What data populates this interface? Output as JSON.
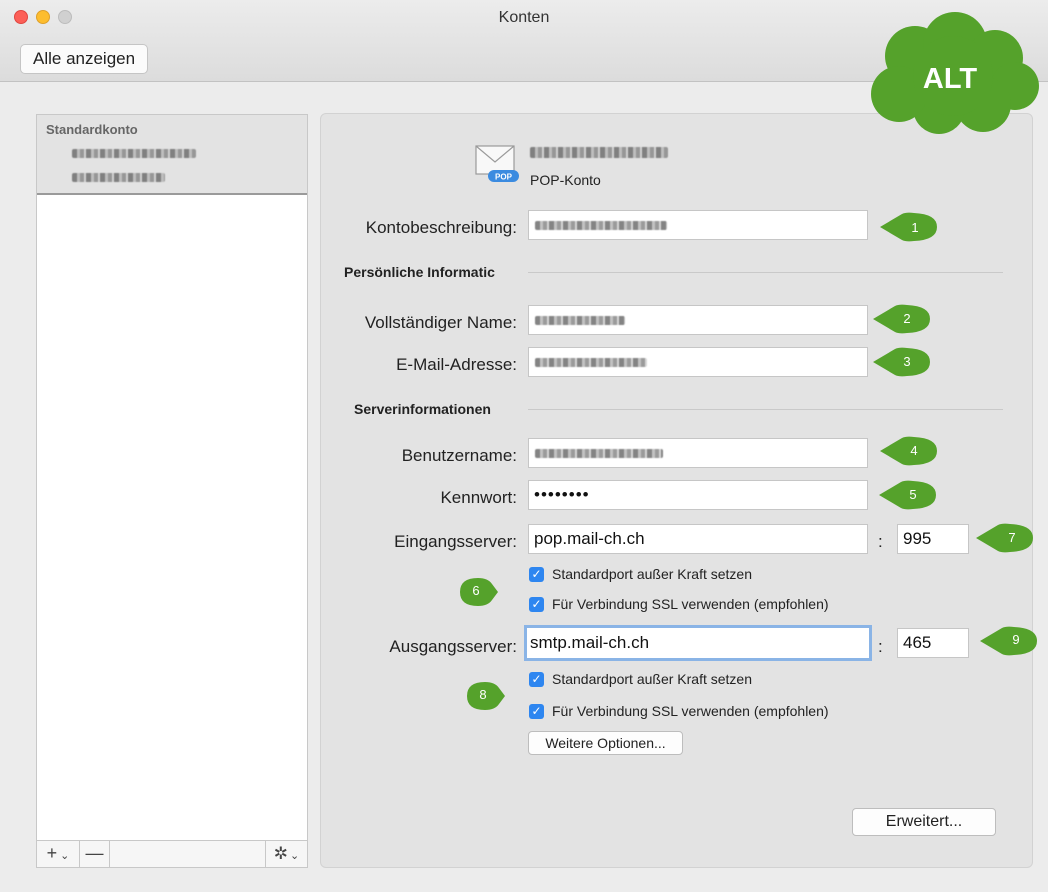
{
  "window": {
    "title": "Konten",
    "show_all_label": "Alle anzeigen"
  },
  "badge": {
    "text": "ALT",
    "color": "#55a22b"
  },
  "sidebar": {
    "group_label": "Standardkonto",
    "footer": {
      "add_label": "+",
      "remove_label": "—",
      "chevron": "v"
    }
  },
  "account": {
    "type_label": "POP-Konto",
    "icon": "envelope-pop-icon"
  },
  "form": {
    "description_label": "Kontobeschreibung:",
    "personal_section": "Persönliche Informatic",
    "fullname_label": "Vollständiger Name:",
    "email_label": "E-Mail-Adresse:",
    "server_section": "Serverinformationen",
    "username_label": "Benutzername:",
    "password_label": "Kennwort:",
    "password_value": "••••••••",
    "incoming_label": "Eingangsserver:",
    "incoming_value": "pop.mail-ch.ch",
    "incoming_port": "995",
    "incoming_override": "Standardport außer Kraft setzen",
    "incoming_ssl": "Für Verbindung SSL verwenden (empfohlen)",
    "outgoing_label": "Ausgangsserver:",
    "outgoing_value": "smtp.mail-ch.ch",
    "outgoing_port": "465",
    "outgoing_override": "Standardport außer Kraft setzen",
    "outgoing_ssl": "Für Verbindung SSL verwenden (empfohlen)",
    "more_options_label": "Weitere Optionen...",
    "advanced_label": "Erweitert...",
    "colon": ":"
  },
  "markers": [
    "1",
    "2",
    "3",
    "4",
    "5",
    "6",
    "7",
    "8",
    "9"
  ],
  "colors": {
    "marker_green": "#55a22b",
    "checkbox_blue": "#2e86f0",
    "focus_ring": "#8ab4e6"
  }
}
